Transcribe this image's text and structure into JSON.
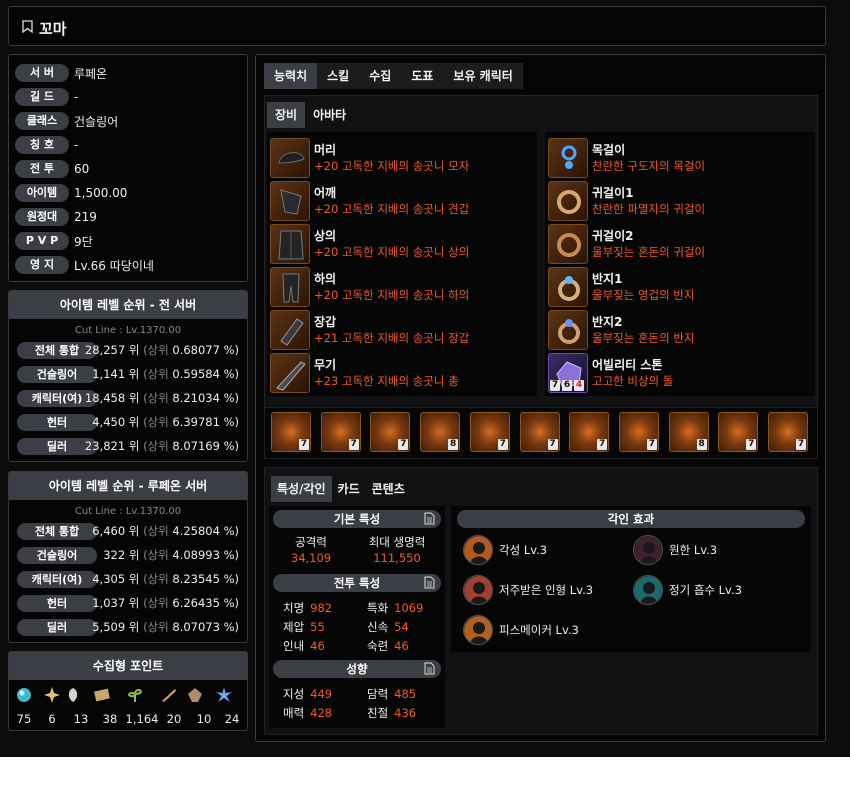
{
  "header": {
    "title": "꼬마"
  },
  "profile": [
    {
      "label": "서 버",
      "value": "루페온"
    },
    {
      "label": "길 드",
      "value": "-"
    },
    {
      "label": "클래스",
      "value": "건슬링어"
    },
    {
      "label": "칭 호",
      "value": "-"
    },
    {
      "label": "전 투",
      "value": "60"
    },
    {
      "label": "아이템",
      "value": "1,500.00"
    },
    {
      "label": "원정대",
      "value": "219"
    },
    {
      "label": "P V P",
      "value": "9단"
    },
    {
      "label": "영 지",
      "value": "Lv.66 따당이네"
    }
  ],
  "rank_all": {
    "title": "아이템 레벨 순위 - 전 서버",
    "cutline": "Cut Line : Lv.1370.00",
    "rows": [
      {
        "label": "전체 통합",
        "rank": "28,257 위",
        "pct_label": "(상위",
        "pct": "0.68077 %)"
      },
      {
        "label": "건슬링어",
        "rank": "1,141 위",
        "pct_label": "(상위",
        "pct": "0.59584 %)"
      },
      {
        "label": "캐릭터(여)",
        "rank": "18,458 위",
        "pct_label": "(상위",
        "pct": "8.21034 %)"
      },
      {
        "label": "헌터",
        "rank": "4,450 위",
        "pct_label": "(상위",
        "pct": "6.39781 %)"
      },
      {
        "label": "딜러",
        "rank": "23,821 위",
        "pct_label": "(상위",
        "pct": "8.07169 %)"
      }
    ]
  },
  "rank_server": {
    "title": "아이템 레벨 순위 - 루페온 서버",
    "cutline": "Cut Line : Lv.1370.00",
    "rows": [
      {
        "label": "전체 통합",
        "rank": "6,460 위",
        "pct_label": "(상위",
        "pct": "4.25804 %)"
      },
      {
        "label": "건슬링어",
        "rank": "322 위",
        "pct_label": "(상위",
        "pct": "4.08993 %)"
      },
      {
        "label": "캐릭터(여)",
        "rank": "4,305 위",
        "pct_label": "(상위",
        "pct": "8.23545 %)"
      },
      {
        "label": "헌터",
        "rank": "1,037 위",
        "pct_label": "(상위",
        "pct": "6.26435 %)"
      },
      {
        "label": "딜러",
        "rank": "5,509 위",
        "pct_label": "(상위",
        "pct": "8.07073 %)"
      }
    ]
  },
  "collection": {
    "title": "수집형 포인트",
    "items": [
      {
        "icon": "island-heart-icon",
        "value": "75",
        "color": "#3fb8c8"
      },
      {
        "icon": "star-icon",
        "value": "6",
        "color": "#e8c06a"
      },
      {
        "icon": "mokoko-seed-icon",
        "value": "13",
        "color": "#cfd8c8"
      },
      {
        "icon": "art-scroll-icon",
        "value": "38",
        "color": "#c9a66b"
      },
      {
        "icon": "sprout-icon",
        "value": "1,164",
        "color": "#8fbf4a"
      },
      {
        "icon": "voyage-icon",
        "value": "20",
        "color": "#d6a25a"
      },
      {
        "icon": "world-tree-leaf-icon",
        "value": "10",
        "color": "#b08a6a"
      },
      {
        "icon": "orpheus-star-icon",
        "value": "24",
        "color": "#6aa8e8"
      }
    ]
  },
  "tabs": [
    "능력치",
    "스킬",
    "수집",
    "도표",
    "보유 캐릭터"
  ],
  "equip_tabs": [
    "장비",
    "아바타"
  ],
  "equip_left": [
    {
      "slot": "머리",
      "item": "+20 고독한 지배의 송곳니 모자"
    },
    {
      "slot": "어깨",
      "item": "+20 고독한 지배의 송곳니 견갑"
    },
    {
      "slot": "상의",
      "item": "+20 고독한 지배의 송곳니 상의"
    },
    {
      "slot": "하의",
      "item": "+20 고독한 지배의 송곳니 하의"
    },
    {
      "slot": "장갑",
      "item": "+21 고독한 지배의 송곳니 장갑"
    },
    {
      "slot": "무기",
      "item": "+23 고독한 지배의 송곳니 총"
    }
  ],
  "equip_right": [
    {
      "slot": "목걸이",
      "item": "찬란한 구도자의 목걸이"
    },
    {
      "slot": "귀걸이1",
      "item": "찬란한 파멸자의 귀걸이"
    },
    {
      "slot": "귀걸이2",
      "item": "울부짖는 혼돈의 귀걸이"
    },
    {
      "slot": "반지1",
      "item": "울부짖는 영겁의 반지"
    },
    {
      "slot": "반지2",
      "item": "울부짖는 혼돈의 반지"
    },
    {
      "slot": "어빌리티 스톤",
      "item": "고고한 비상의 돌",
      "badges": [
        "7",
        "6",
        "4"
      ]
    }
  ],
  "gems": [
    "7",
    "7",
    "7",
    "8",
    "7",
    "7",
    "7",
    "7",
    "8",
    "7",
    "7"
  ],
  "trait_tabs": [
    "특성/각인",
    "카드",
    "콘텐츠"
  ],
  "basic": {
    "title": "기본 특성",
    "attack_label": "공격력",
    "attack": "34,109",
    "hp_label": "최대 생명력",
    "hp": "111,550"
  },
  "combat": {
    "title": "전투 특성",
    "rows": [
      {
        "k": "치명",
        "v": "982"
      },
      {
        "k": "특화",
        "v": "1069"
      },
      {
        "k": "제압",
        "v": "55"
      },
      {
        "k": "신속",
        "v": "54"
      },
      {
        "k": "인내",
        "v": "46"
      },
      {
        "k": "숙련",
        "v": "46"
      }
    ]
  },
  "tendency": {
    "title": "성향",
    "rows": [
      {
        "k": "지성",
        "v": "449"
      },
      {
        "k": "담력",
        "v": "485"
      },
      {
        "k": "매력",
        "v": "428"
      },
      {
        "k": "친절",
        "v": "436"
      }
    ]
  },
  "engravings": {
    "title": "각인 효과",
    "items": [
      {
        "name": "각성 Lv.3"
      },
      {
        "name": "원한 Lv.3"
      },
      {
        "name": "저주받은 인형 Lv.3"
      },
      {
        "name": "정기 흡수 Lv.3"
      },
      {
        "name": "피스메이커 Lv.3"
      }
    ]
  }
}
